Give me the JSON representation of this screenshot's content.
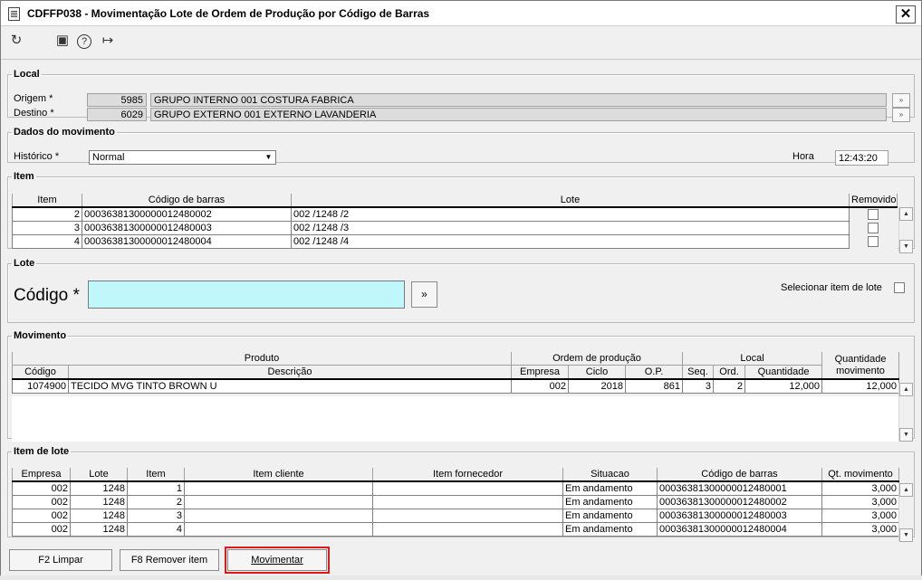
{
  "window": {
    "title": "CDFFP038 - Movimentação Lote de Ordem de Produção por Código de Barras"
  },
  "toolbar": {
    "icons": [
      "refresh-icon",
      "calendar-icon",
      "help-icon",
      "exit-icon"
    ],
    "glyphs": [
      "↻",
      "▣",
      "?",
      "↦"
    ]
  },
  "local": {
    "legend": "Local",
    "origem": {
      "label": "Origem *",
      "code": "5985",
      "name": "GRUPO INTERNO 001 COSTURA FABRICA"
    },
    "destino": {
      "label": "Destino *",
      "code": "6029",
      "name": "GRUPO EXTERNO 001 EXTERNO LAVANDERIA"
    },
    "lookup_glyph": "»"
  },
  "dados": {
    "legend": "Dados do movimento",
    "historico_label": "Histórico *",
    "historico_value": "Normal",
    "hora_label": "Hora",
    "hora_value": "12:43:20"
  },
  "item": {
    "legend": "Item",
    "headers": [
      "Item",
      "Código de barras",
      "Lote",
      "Removido"
    ],
    "rows": [
      {
        "item": "2",
        "codigo": "00036381300000012480002",
        "lote": "002 /1248 /2"
      },
      {
        "item": "3",
        "codigo": "00036381300000012480003",
        "lote": "002 /1248 /3"
      },
      {
        "item": "4",
        "codigo": "00036381300000012480004",
        "lote": "002 /1248 /4"
      }
    ]
  },
  "lote": {
    "legend": "Lote",
    "codigo_label": "Código *",
    "codigo_value": "",
    "go_glyph": "»",
    "selecionar_label": "Selecionar item de lote"
  },
  "movimento": {
    "legend": "Movimento",
    "group_headers": {
      "produto": "Produto",
      "ordem": "Ordem de produção",
      "local": "Local",
      "quantidade": "Quantidade movimento"
    },
    "headers": [
      "Código",
      "Descrição",
      "Empresa",
      "Ciclo",
      "O.P.",
      "Seq.",
      "Ord.",
      "Quantidade"
    ],
    "rows": [
      {
        "codigo": "1074900",
        "descricao": "TECIDO MVG TINTO BROWN U",
        "empresa": "002",
        "ciclo": "2018",
        "op": "861",
        "seq": "3",
        "ord": "2",
        "quantidade": "12,000",
        "qtd_mov": "12,000"
      }
    ]
  },
  "item_lote": {
    "legend": "Item de lote",
    "headers": [
      "Empresa",
      "Lote",
      "Item",
      "Item cliente",
      "Item fornecedor",
      "Situacao",
      "Código de barras",
      "Qt. movimento"
    ],
    "rows": [
      {
        "empresa": "002",
        "lote": "1248",
        "item": "1",
        "cliente": "",
        "fornecedor": "",
        "situacao": "Em andamento",
        "codigo": "00036381300000012480001",
        "qt": "3,000"
      },
      {
        "empresa": "002",
        "lote": "1248",
        "item": "2",
        "cliente": "",
        "fornecedor": "",
        "situacao": "Em andamento",
        "codigo": "00036381300000012480002",
        "qt": "3,000"
      },
      {
        "empresa": "002",
        "lote": "1248",
        "item": "3",
        "cliente": "",
        "fornecedor": "",
        "situacao": "Em andamento",
        "codigo": "00036381300000012480003",
        "qt": "3,000"
      },
      {
        "empresa": "002",
        "lote": "1248",
        "item": "4",
        "cliente": "",
        "fornecedor": "",
        "situacao": "Em andamento",
        "codigo": "00036381300000012480004",
        "qt": "3,000"
      }
    ]
  },
  "buttons": {
    "limpar": "F2 Limpar",
    "remover": "F8 Remover item",
    "movimentar": "Movimentar"
  },
  "colors": {
    "input_highlight": "#bff7fb",
    "selection_outline": "#e01818"
  }
}
